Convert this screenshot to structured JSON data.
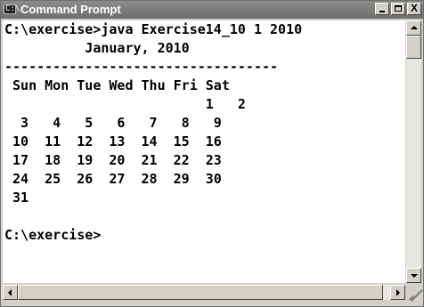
{
  "window": {
    "title": "Command Prompt",
    "icon": "command-prompt-icon",
    "icon_glyph": "C:\\",
    "buttons": {
      "minimize": "minimize-icon",
      "maximize": "maximize-icon",
      "close": "close-icon",
      "close_glyph": "X"
    }
  },
  "console": {
    "lines": [
      "C:\\exercise>java Exercise14_10 1 2010",
      "          January, 2010",
      "----------------------------------",
      " Sun Mon Tue Wed Thu Fri Sat",
      "                         1   2",
      "  3   4   5   6   7   8   9",
      " 10  11  12  13  14  15  16",
      " 17  18  19  20  21  22  23",
      " 24  25  26  27  28  29  30",
      " 31",
      "",
      "C:\\exercise>"
    ]
  },
  "colors": {
    "console_background": "#ffffff",
    "console_text": "#000000",
    "titlebar": "#7a7a7a"
  }
}
